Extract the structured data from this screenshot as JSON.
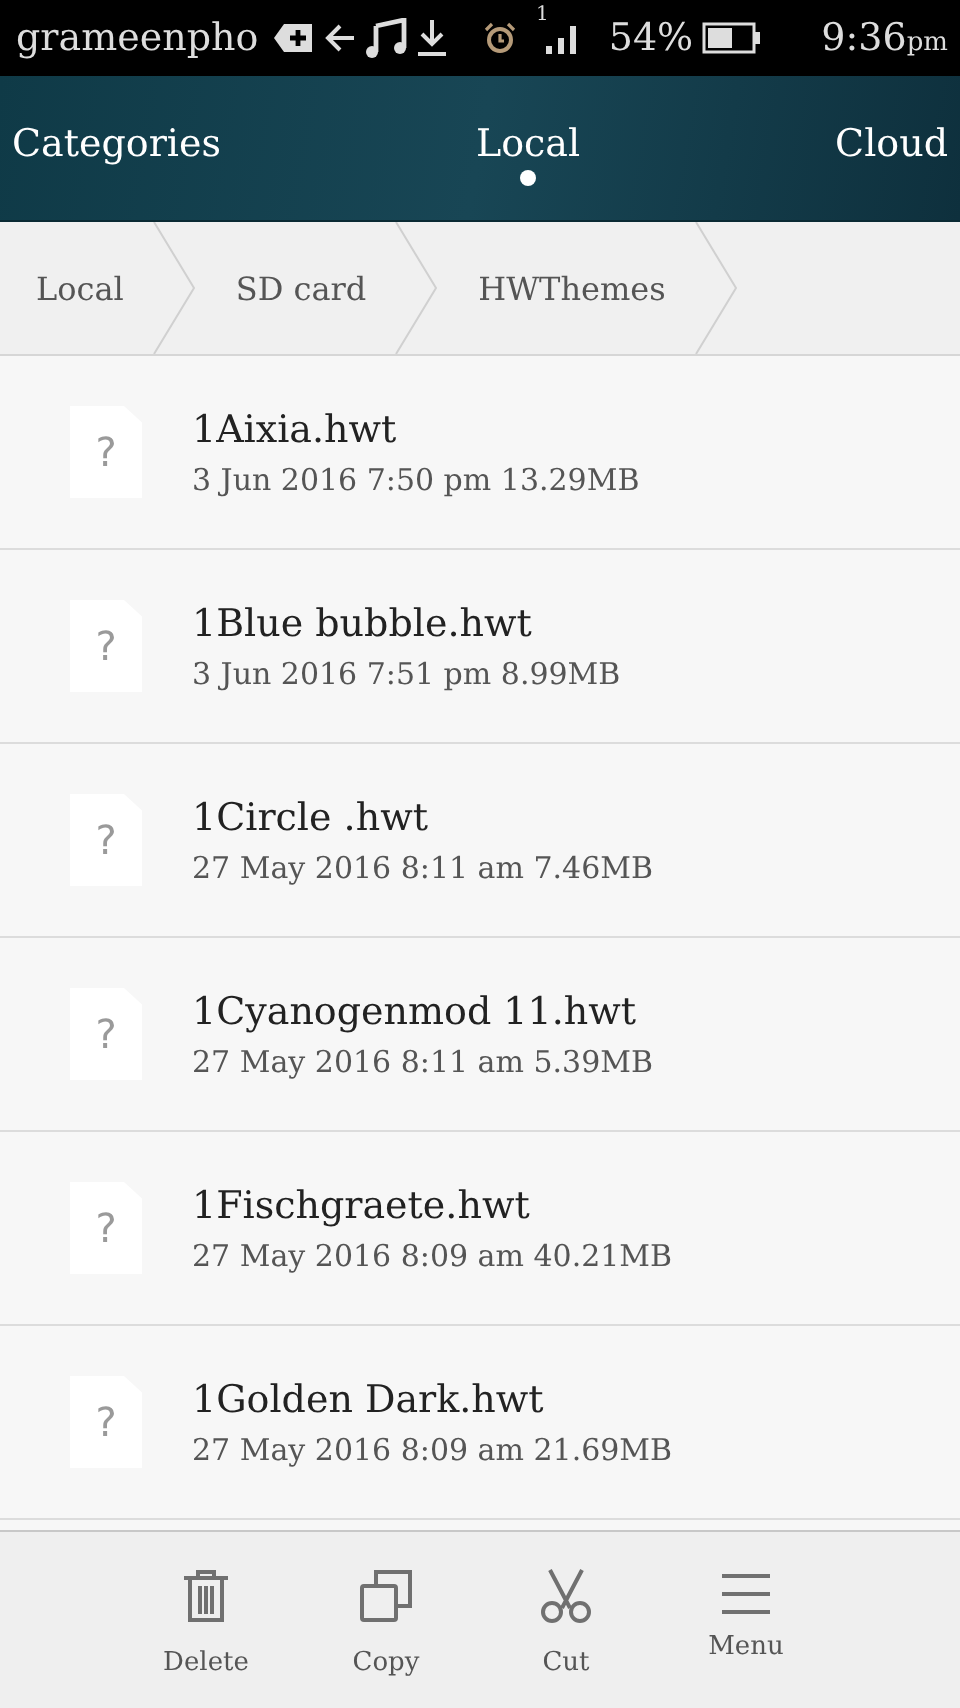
{
  "status_bar": {
    "carrier": "grameenpho",
    "signal_sim": "1",
    "battery": "54%",
    "time": "9:36",
    "ampm": "pm"
  },
  "tabs": [
    {
      "label": "Categories",
      "selected": false
    },
    {
      "label": "Local",
      "selected": true
    },
    {
      "label": "Cloud",
      "selected": false
    }
  ],
  "breadcrumb": [
    "Local",
    "SD card",
    "HWThemes"
  ],
  "files": [
    {
      "name": "1Aixia.hwt",
      "details": "3 Jun 2016 7:50 pm 13.29MB",
      "icon_text": "?"
    },
    {
      "name": "1Blue bubble.hwt",
      "details": "3 Jun 2016 7:51 pm 8.99MB",
      "icon_text": "?"
    },
    {
      "name": "1Circle .hwt",
      "details": "27 May 2016 8:11 am 7.46MB",
      "icon_text": "?"
    },
    {
      "name": "1Cyanogenmod 11.hwt",
      "details": "27 May 2016 8:11 am 5.39MB",
      "icon_text": "?"
    },
    {
      "name": "1Fischgraete.hwt",
      "details": "27 May 2016 8:09 am 40.21MB",
      "icon_text": "?"
    },
    {
      "name": "1Golden Dark.hwt",
      "details": "27 May 2016 8:09 am 21.69MB",
      "icon_text": "?"
    }
  ],
  "actions": [
    {
      "label": "Delete",
      "kind": "delete"
    },
    {
      "label": "Copy",
      "kind": "copy"
    },
    {
      "label": "Cut",
      "kind": "cut"
    },
    {
      "label": "Menu",
      "kind": "menu"
    }
  ]
}
